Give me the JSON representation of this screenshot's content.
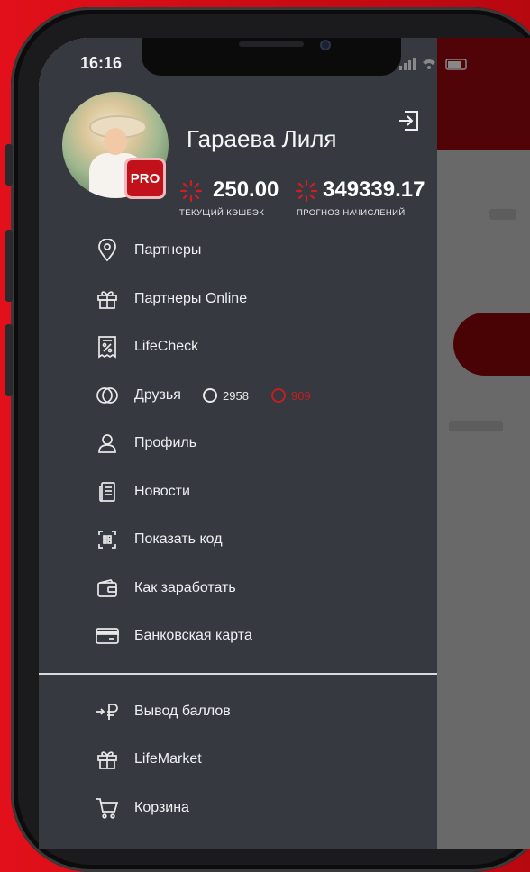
{
  "status_bar": {
    "time": "16:16"
  },
  "profile": {
    "name": "Гараева Лиля",
    "badge": "PRO",
    "cashback": {
      "value": "250.00",
      "label": "ТЕКУЩИЙ КЭШБЭК"
    },
    "forecast": {
      "value": "349339.17",
      "label": "ПРОГНОЗ НАЧИСЛЕНИЙ"
    }
  },
  "menu": {
    "items": [
      {
        "label": "Партнеры",
        "icon": "map-pin-icon"
      },
      {
        "label": "Партнеры Online",
        "icon": "gift-icon"
      },
      {
        "label": "LifeCheck",
        "icon": "receipt-percent-icon"
      },
      {
        "label": "Друзья",
        "icon": "friends-icon",
        "count_white": "2958",
        "count_red": "909"
      },
      {
        "label": "Профиль",
        "icon": "user-icon"
      },
      {
        "label": "Новости",
        "icon": "news-icon"
      },
      {
        "label": "Показать код",
        "icon": "qr-scan-icon"
      },
      {
        "label": "Как заработать",
        "icon": "wallet-icon"
      },
      {
        "label": "Банковская карта",
        "icon": "credit-card-icon"
      }
    ],
    "secondary": [
      {
        "label": "Вывод баллов",
        "icon": "withdraw-ruble-icon"
      },
      {
        "label": "LifeMarket",
        "icon": "gift-icon"
      },
      {
        "label": "Корзина",
        "icon": "cart-icon"
      }
    ]
  },
  "colors": {
    "accent": "#c51d22",
    "drawer_bg": "#363940",
    "text": "#eef0f2"
  }
}
